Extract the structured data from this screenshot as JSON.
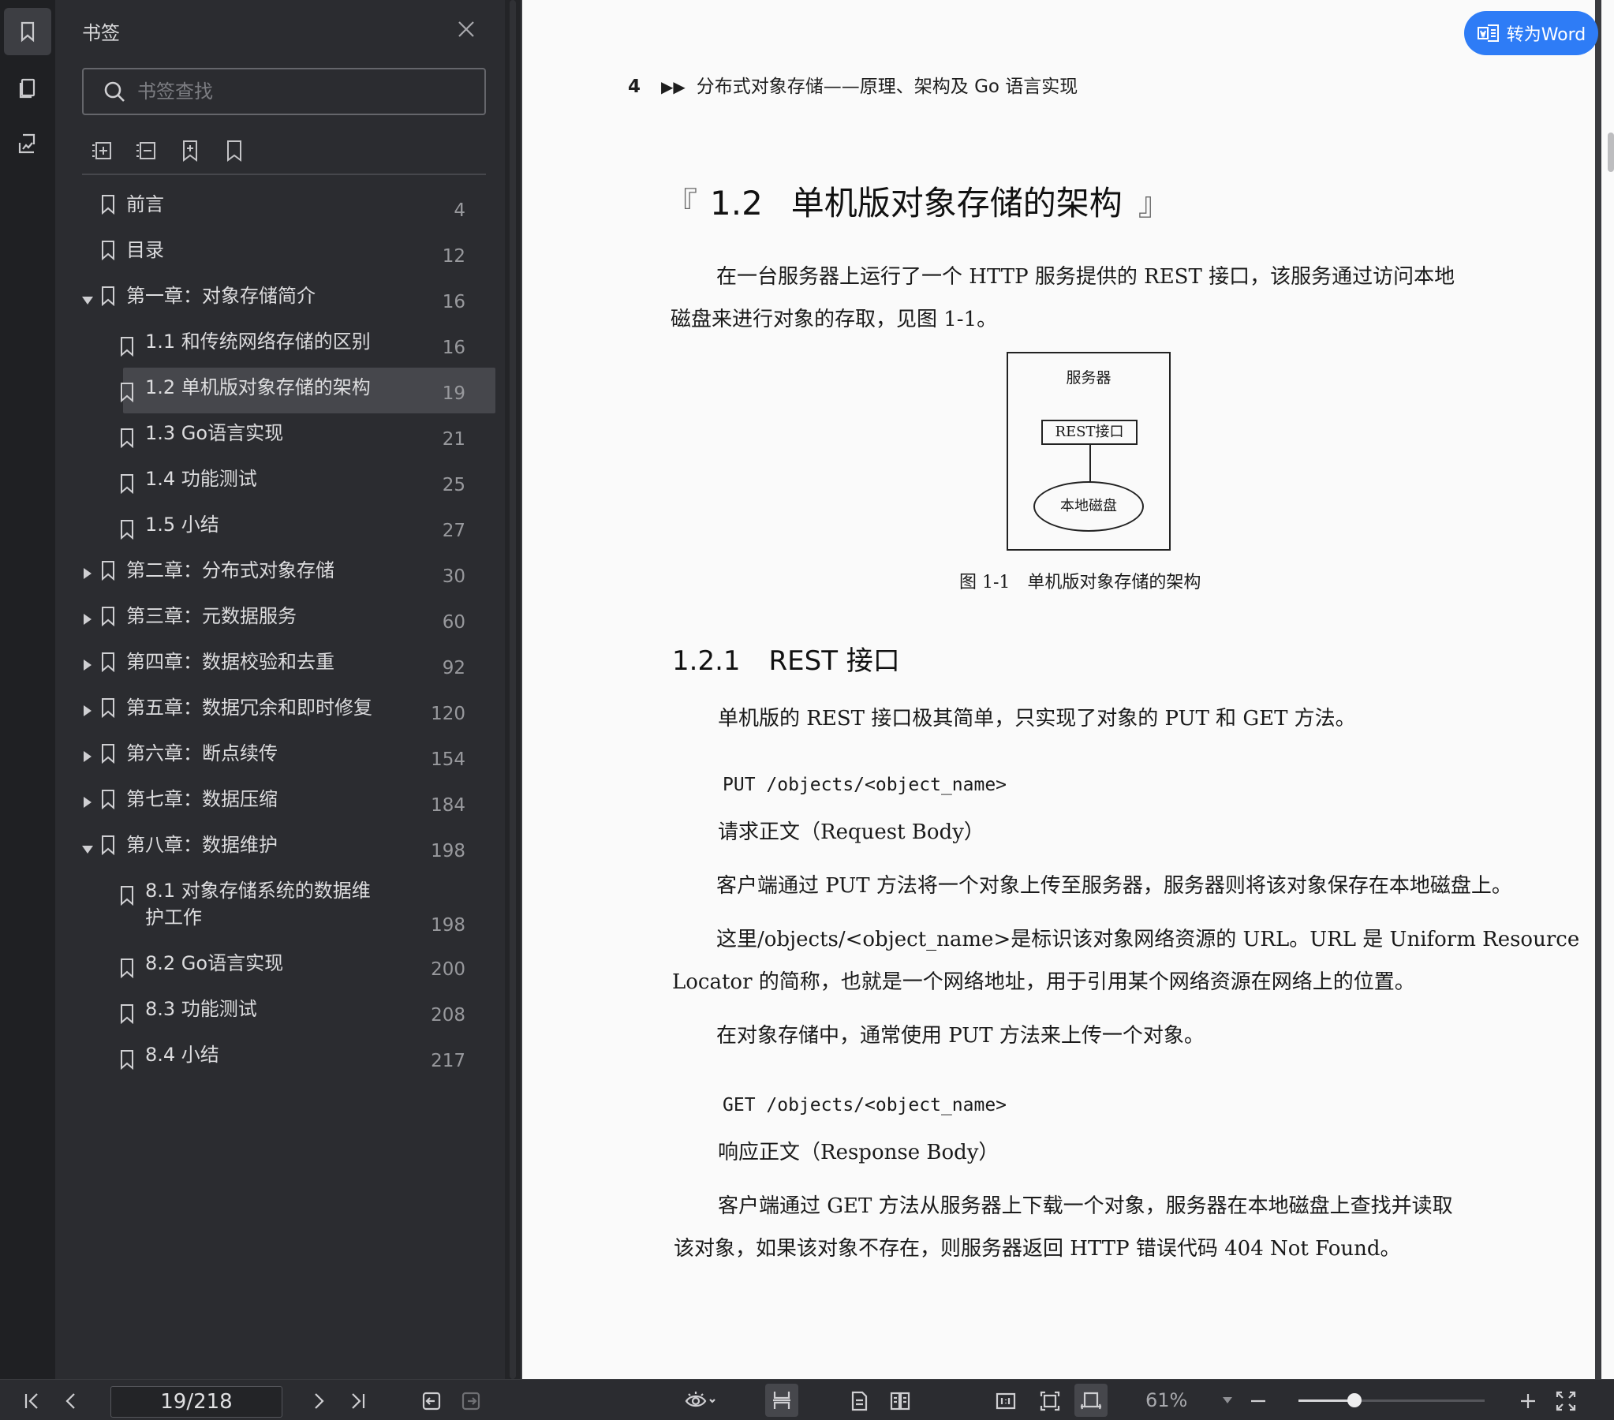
{
  "panel": {
    "title": "书签",
    "search_placeholder": "书签查找"
  },
  "bookmarks": [
    {
      "label": "前言",
      "page": "4",
      "level": 0,
      "expander": "none"
    },
    {
      "label": "目录",
      "page": "12",
      "level": 0,
      "expander": "none"
    },
    {
      "label": "第一章：对象存储简介",
      "page": "16",
      "level": 0,
      "expander": "expanded"
    },
    {
      "label": "1.1 和传统网络存储的区别",
      "page": "16",
      "level": 1,
      "expander": "none"
    },
    {
      "label": "1.2 单机版对象存储的架构",
      "page": "19",
      "level": 1,
      "expander": "none",
      "selected": true
    },
    {
      "label": "1.3 Go语言实现",
      "page": "21",
      "level": 1,
      "expander": "none"
    },
    {
      "label": "1.4 功能测试",
      "page": "25",
      "level": 1,
      "expander": "none"
    },
    {
      "label": "1.5 小结",
      "page": "27",
      "level": 1,
      "expander": "none"
    },
    {
      "label": "第二章：分布式对象存储",
      "page": "30",
      "level": 0,
      "expander": "collapsed"
    },
    {
      "label": "第三章：元数据服务",
      "page": "60",
      "level": 0,
      "expander": "collapsed"
    },
    {
      "label": "第四章：数据校验和去重",
      "page": "92",
      "level": 0,
      "expander": "collapsed"
    },
    {
      "label": "第五章：数据冗余和即时修复",
      "page": "120",
      "level": 0,
      "expander": "collapsed"
    },
    {
      "label": "第六章：断点续传",
      "page": "154",
      "level": 0,
      "expander": "collapsed"
    },
    {
      "label": "第七章：数据压缩",
      "page": "184",
      "level": 0,
      "expander": "collapsed"
    },
    {
      "label": "第八章：数据维护",
      "page": "198",
      "level": 0,
      "expander": "expanded"
    },
    {
      "label": "8.1 对象存储系统的数据维",
      "label2": "护工作",
      "page": "198",
      "level": 1,
      "expander": "none"
    },
    {
      "label": "8.2 Go语言实现",
      "page": "200",
      "level": 1,
      "expander": "none"
    },
    {
      "label": "8.3 功能测试",
      "page": "208",
      "level": 1,
      "expander": "none"
    },
    {
      "label": "8.4 小结",
      "page": "217",
      "level": 1,
      "expander": "none"
    }
  ],
  "convert_button": "转为Word",
  "doc": {
    "header_num": "4",
    "header_arrow": "▶▶",
    "header_text": "分布式对象存储——原理、架构及 Go 语言实现",
    "bracket_open": "『",
    "section_num": "1.2",
    "section_title": "单机版对象存储的架构",
    "bracket_close": "』",
    "p1_line1": "在一台服务器上运行了一个 HTTP 服务提供的 REST 接口，该服务通过访问本地",
    "p1_line2": "磁盘来进行对象的存取，见图 1-1。",
    "fig_server": "服务器",
    "fig_rest": "REST接口",
    "fig_disk": "本地磁盘",
    "fig_caption": "图 1-1　单机版对象存储的架构",
    "sub_num": "1.2.1",
    "sub_title": "REST 接口",
    "p2": "单机版的 REST 接口极其简单，只实现了对象的 PUT 和 GET 方法。",
    "code1": "PUT /objects/<object_name>",
    "p3": "请求正文（Request Body）",
    "p4": "客户端通过 PUT 方法将一个对象上传至服务器，服务器则将该对象保存在本地磁盘上。",
    "p5_line1": "这里/objects/<object_name>是标识该对象网络资源的 URL。URL 是 Uniform Resource",
    "p5_line2": "Locator 的简称，也就是一个网络地址，用于引用某个网络资源在网络上的位置。",
    "p6": "在对象存储中，通常使用 PUT 方法来上传一个对象。",
    "code2": "GET /objects/<object_name>",
    "p7": "响应正文（Response Body）",
    "p8_line1": "客户端通过 GET 方法从服务器上下载一个对象，服务器在本地磁盘上查找并读取",
    "p8_line2": "该对象，如果该对象不存在，则服务器返回 HTTP 错误代码 404 Not Found。"
  },
  "statusbar": {
    "page_indicator": "19/218",
    "zoom": "61%",
    "zoom_level": 0.3
  }
}
